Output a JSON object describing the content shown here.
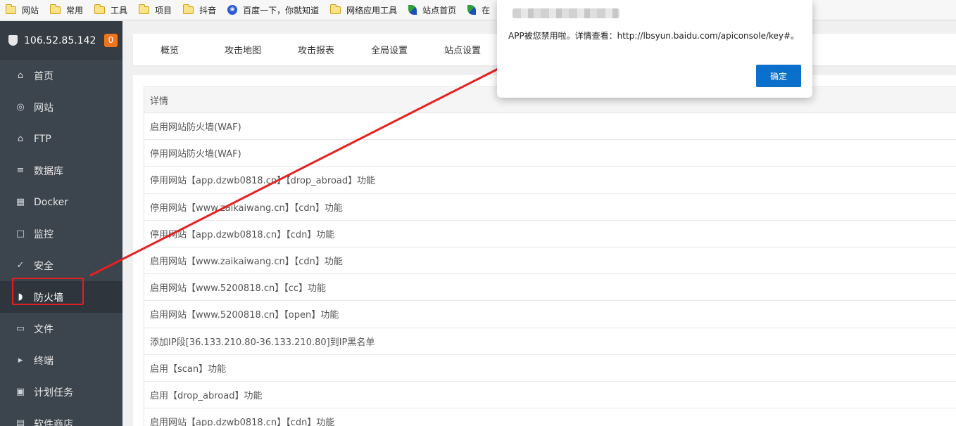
{
  "bookmarks": [
    {
      "label": "网站",
      "icon": "folder-icon"
    },
    {
      "label": "常用",
      "icon": "folder-icon"
    },
    {
      "label": "工具",
      "icon": "folder-icon"
    },
    {
      "label": "项目",
      "icon": "folder-icon"
    },
    {
      "label": "抖音",
      "icon": "folder-icon"
    },
    {
      "label": "百度一下，你就知道",
      "icon": "baidu-paw-icon"
    },
    {
      "label": "网络应用工具",
      "icon": "folder-icon"
    },
    {
      "label": "站点首页",
      "icon": "site-logo-icon"
    },
    {
      "label": "在",
      "icon": "site-logo-icon"
    }
  ],
  "sidebar": {
    "server_ip": "106.52.85.142",
    "badge_count": "0",
    "items": [
      {
        "label": "首页",
        "icon": "home-icon"
      },
      {
        "label": "网站",
        "icon": "globe-icon"
      },
      {
        "label": "FTP",
        "icon": "ftp-icon"
      },
      {
        "label": "数据库",
        "icon": "database-icon"
      },
      {
        "label": "Docker",
        "icon": "docker-icon"
      },
      {
        "label": "监控",
        "icon": "monitor-icon"
      },
      {
        "label": "安全",
        "icon": "shield-check-icon"
      },
      {
        "label": "防火墙",
        "icon": "firewall-shield-icon"
      },
      {
        "label": "文件",
        "icon": "folder-icon"
      },
      {
        "label": "终端",
        "icon": "terminal-icon"
      },
      {
        "label": "计划任务",
        "icon": "calendar-icon"
      },
      {
        "label": "软件商店",
        "icon": "store-icon"
      }
    ]
  },
  "tabs": [
    "概览",
    "攻击地图",
    "攻击报表",
    "全局设置",
    "站点设置"
  ],
  "table": {
    "header": "详情",
    "rows": [
      "启用网站防火墙(WAF)",
      "停用网站防火墙(WAF)",
      "停用网站【app.dzwb0818.cn】【drop_abroad】功能",
      "停用网站【www.zaikaiwang.cn】【cdn】功能",
      "停用网站【app.dzwb0818.cn】【cdn】功能",
      "启用网站【www.zaikaiwang.cn】【cdn】功能",
      "启用网站【www.5200818.cn】【cc】功能",
      "启用网站【www.5200818.cn】【open】功能",
      "添加IP段[36.133.210.80-36.133.210.80]到IP黑名单",
      "启用【scan】功能",
      "启用【drop_abroad】功能",
      "启用网站【app.dzwb0818.cn】【cdn】功能"
    ]
  },
  "dialog": {
    "message": "APP被您禁用啦。详情查看：http://lbsyun.baidu.com/apiconsole/key#。",
    "ok_label": "确定"
  },
  "colors": {
    "sidebar_bg": "#3c444d",
    "badge": "#f0741b",
    "annotation_red": "#e02020",
    "primary_button": "#0b6fcc"
  }
}
